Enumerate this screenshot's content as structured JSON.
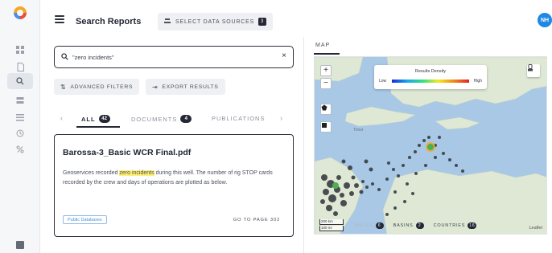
{
  "header": {
    "title": "Search Reports",
    "select_sources_label": "SELECT DATA SOURCES",
    "select_sources_count": "3",
    "avatar_initials": "NH"
  },
  "search": {
    "value": "\"zero incidents\""
  },
  "actions": {
    "advanced_filters": "ADVANCED FILTERS",
    "export_results": "EXPORT RESULTS"
  },
  "tabs": [
    {
      "label": "ALL",
      "count": "42",
      "active": true
    },
    {
      "label": "DOCUMENTS",
      "count": "4",
      "active": false
    },
    {
      "label": "PUBLICATIONS",
      "count": "",
      "active": false
    }
  ],
  "result": {
    "title": "Barossa-3_Basic WCR Final.pdf",
    "text_before": "Geoservices recorded ",
    "highlight": "zero incidents",
    "text_after": " during this well. The number of rig STOP cards recorded by the crew and days of operations are plotted as below.",
    "tag": "Public Databases",
    "goto": "GO TO PAGE 302"
  },
  "map": {
    "tab_label": "MAP",
    "legend_title": "Results Density",
    "legend_low": "Low",
    "legend_high": "High",
    "scale_km": "200 km",
    "scale_mi": "100 mi",
    "chips": [
      {
        "label": "WELLS",
        "count": "6"
      },
      {
        "label": "BASINS",
        "count": "2"
      },
      {
        "label": "COUNTRIES",
        "count": "16"
      }
    ],
    "attribution": "Leaflet",
    "place_label": "Timor"
  },
  "colors": {
    "accent": "#1e88e5",
    "highlight": "#fff176",
    "sea": "#a8c8e6",
    "land": "#dfe8d5"
  }
}
